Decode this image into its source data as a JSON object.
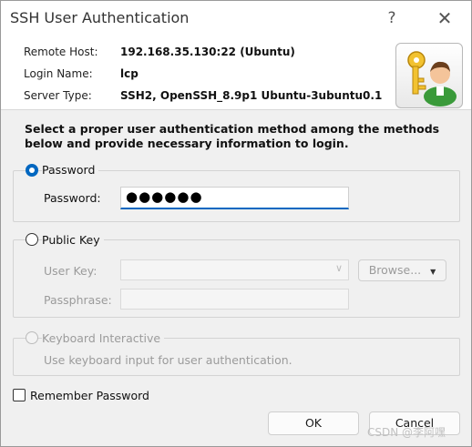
{
  "window": {
    "title": "SSH User Authentication",
    "help_glyph": "?",
    "close_glyph": "✕"
  },
  "info": {
    "remote_host_label": "Remote Host:",
    "remote_host_value": "192.168.35.130:22 (Ubuntu)",
    "login_name_label": "Login Name:",
    "login_name_value": "lcp",
    "server_type_label": "Server Type:",
    "server_type_value": "SSH2, OpenSSH_8.9p1 Ubuntu-3ubuntu0.1",
    "logo_icon": "key-user-icon"
  },
  "instructions": "Select a proper user authentication method among the methods below and provide necessary information to login.",
  "password_method": {
    "label": "Password",
    "selected": true,
    "field_label": "Password:",
    "field_value": "●●●●●●"
  },
  "public_key_method": {
    "label": "Public Key",
    "selected": false,
    "user_key_label": "User Key:",
    "user_key_value": "",
    "browse_label": "Browse...",
    "passphrase_label": "Passphrase:"
  },
  "keyboard_method": {
    "label": "Keyboard Interactive",
    "description": "Use keyboard input for user authentication."
  },
  "remember_password": {
    "label": "Remember Password",
    "checked": false
  },
  "buttons": {
    "ok": "OK",
    "cancel": "Cancel"
  },
  "watermark": "CSDN @李阿嘿",
  "colors": {
    "accent": "#0067c0",
    "disabled_text": "#9b9b9b"
  }
}
